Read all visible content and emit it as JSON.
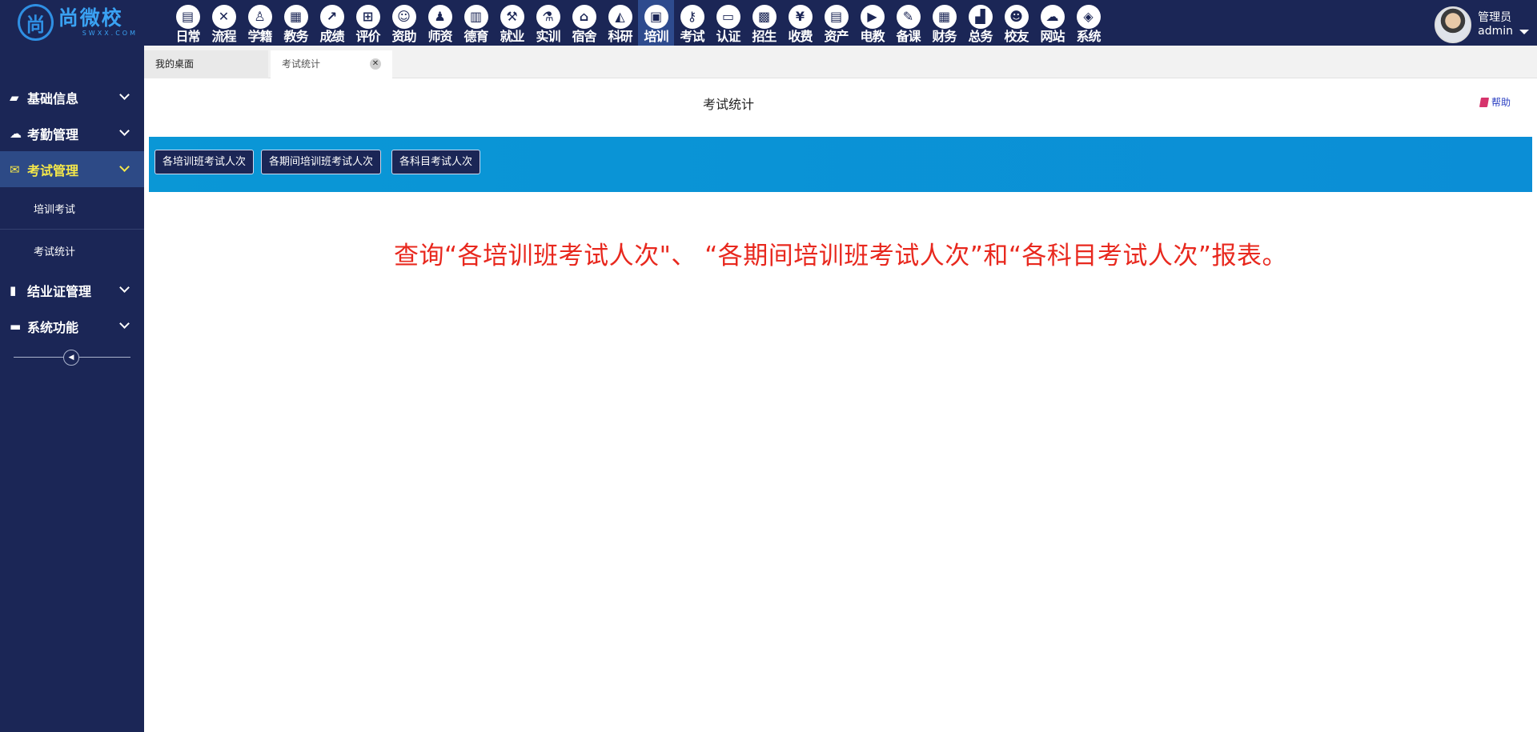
{
  "app": {
    "logo_name": "尚微校",
    "logo_sub": "SWXX.COM",
    "logo_mark": "尚"
  },
  "modules": [
    {
      "label": "日常",
      "icon": "doc-icon",
      "glyph": "▤"
    },
    {
      "label": "流程",
      "icon": "flow-icon",
      "glyph": "✕"
    },
    {
      "label": "学籍",
      "icon": "person-icon",
      "glyph": "♙"
    },
    {
      "label": "教务",
      "icon": "calendar-icon",
      "glyph": "▦"
    },
    {
      "label": "成绩",
      "icon": "chart-icon",
      "glyph": "↗"
    },
    {
      "label": "评价",
      "icon": "calendar-plus-icon",
      "glyph": "⊞"
    },
    {
      "label": "资助",
      "icon": "user-icon",
      "glyph": "☺"
    },
    {
      "label": "师资",
      "icon": "teacher-icon",
      "glyph": "♟"
    },
    {
      "label": "德育",
      "icon": "book-icon",
      "glyph": "▥"
    },
    {
      "label": "就业",
      "icon": "hammer-icon",
      "glyph": "⚒"
    },
    {
      "label": "实训",
      "icon": "lab-icon",
      "glyph": "⚗"
    },
    {
      "label": "宿舍",
      "icon": "home-icon",
      "glyph": "⌂"
    },
    {
      "label": "科研",
      "icon": "graduation-icon",
      "glyph": "◭"
    },
    {
      "label": "培训",
      "icon": "image-icon",
      "glyph": "▣",
      "active": true
    },
    {
      "label": "考试",
      "icon": "key-icon",
      "glyph": "⚷"
    },
    {
      "label": "认证",
      "icon": "monitor-icon",
      "glyph": "▭"
    },
    {
      "label": "招生",
      "icon": "bus-icon",
      "glyph": "▩"
    },
    {
      "label": "收费",
      "icon": "yen-icon",
      "glyph": "¥"
    },
    {
      "label": "资产",
      "icon": "train-icon",
      "glyph": "▤"
    },
    {
      "label": "电教",
      "icon": "file-video-icon",
      "glyph": "▶"
    },
    {
      "label": "备课",
      "icon": "edit-icon",
      "glyph": "✎"
    },
    {
      "label": "财务",
      "icon": "newspaper-icon",
      "glyph": "▦"
    },
    {
      "label": "总务",
      "icon": "signal-icon",
      "glyph": "▟"
    },
    {
      "label": "校友",
      "icon": "users-icon",
      "glyph": "☻"
    },
    {
      "label": "网站",
      "icon": "cloud-icon",
      "glyph": "☁"
    },
    {
      "label": "系统",
      "icon": "cube-icon",
      "glyph": "◈"
    }
  ],
  "user": {
    "role": "管理员",
    "name": "admin"
  },
  "sidebar": {
    "items": [
      {
        "label": "基础信息",
        "icon": "book-icon",
        "glyph": "▰"
      },
      {
        "label": "考勤管理",
        "icon": "cloud-icon",
        "glyph": "☁"
      },
      {
        "label": "考试管理",
        "icon": "envelope-icon",
        "glyph": "✉",
        "active": true
      },
      {
        "label": "结业证管理",
        "icon": "file-icon",
        "glyph": "▮"
      },
      {
        "label": "系统功能",
        "icon": "folder-icon",
        "glyph": "▬"
      }
    ],
    "subitems": [
      {
        "label": "培训考试"
      },
      {
        "label": "考试统计"
      }
    ]
  },
  "tabs": [
    {
      "label": "我的桌面"
    },
    {
      "label": "考试统计",
      "close": "✕"
    }
  ],
  "main": {
    "title": "考试统计",
    "help_label": "帮助",
    "buttons": [
      {
        "label": "各培训班考试人次"
      },
      {
        "label": "各期间培训班考试人次"
      },
      {
        "label": "各科目考试人次"
      }
    ],
    "notice": "查询“各培训班考试人次\"、 “各期间培训班考试人次”和“各科目考试人次”报表。"
  },
  "colors": {
    "nav_bg": "#1b2656",
    "active_nav": "#2d4a86",
    "active_text": "#f5e84a",
    "toolbar_bg": "#0a97d6",
    "notice_text": "#e8281e",
    "help_link": "#2a3fc2"
  }
}
